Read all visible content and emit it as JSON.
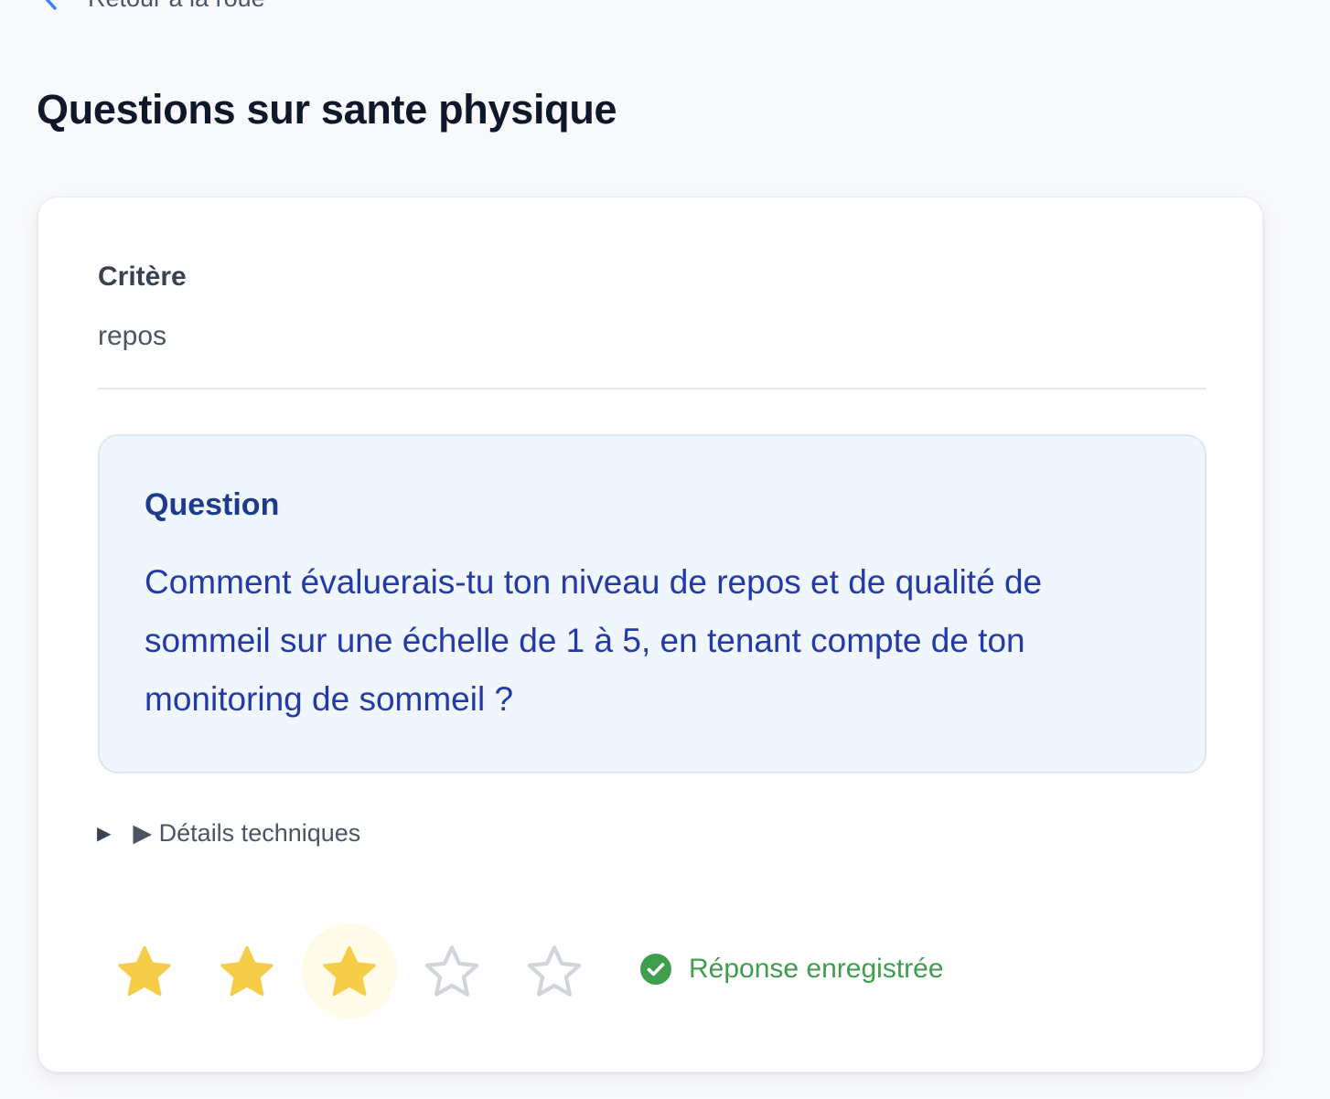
{
  "nav": {
    "back_label": "Retour à la roue"
  },
  "page": {
    "title": "Questions sur sante physique"
  },
  "criterion": {
    "label": "Critère",
    "value": "repos"
  },
  "question": {
    "label": "Question",
    "text": "Comment évaluerais-tu ton niveau de repos et de qualité de sommeil sur une échelle de 1 à 5, en tenant compte de ton monitoring de sommeil ?"
  },
  "details": {
    "marker": "▶",
    "label": "▶ Détails techniques"
  },
  "rating": {
    "value": 3,
    "max": 5,
    "filled_color": "#f5cd47",
    "empty_color": "#d1d5db",
    "hover_bg": "#fefbe8"
  },
  "status": {
    "text": "Réponse enregistrée",
    "icon": "check-circle-icon",
    "color": "#3f9d4d"
  }
}
